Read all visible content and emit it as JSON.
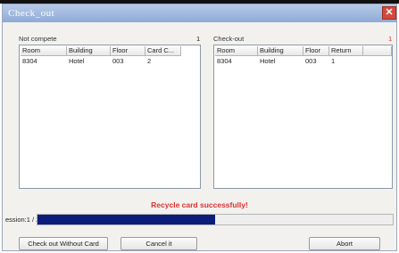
{
  "window": {
    "title": "Check_out",
    "close_glyph": "✕"
  },
  "left_panel": {
    "label": "Not compete",
    "count": "1",
    "columns": [
      "Room",
      "Building",
      "Floor",
      "Card C..."
    ],
    "rows": [
      [
        "8304",
        "Hotel",
        "003",
        "2"
      ]
    ]
  },
  "right_panel": {
    "label": "Check-out",
    "count": "1",
    "columns": [
      "Room",
      "Building",
      "Floor",
      "Return"
    ],
    "rows": [
      [
        "8304",
        "Hotel",
        "003",
        "1"
      ]
    ]
  },
  "status_message": "Recycle card successfully!",
  "session": {
    "label": "ession:1 / 2",
    "progress_fraction": 0.5
  },
  "buttons": {
    "checkout_without_card": "Check out Without Card",
    "cancel": "Cancel it",
    "abort": "Abort"
  },
  "colors": {
    "status_text": "#e03030",
    "progress_fill": "#0b1c7a",
    "count_right": "#e03030"
  }
}
